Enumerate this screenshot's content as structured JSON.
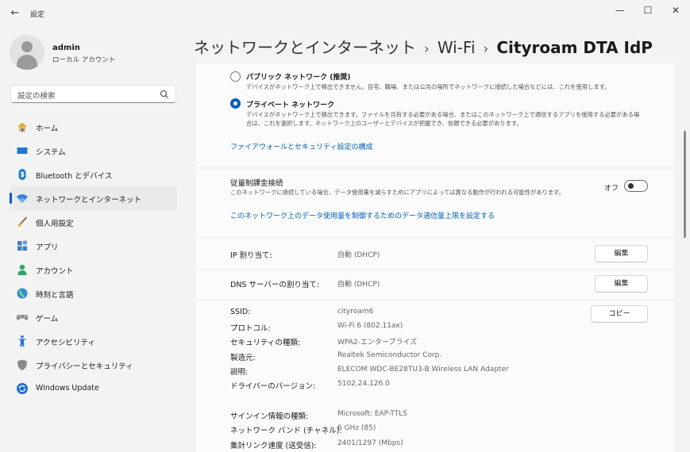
{
  "window": {
    "title": "設定",
    "back_glyph": "←",
    "min_glyph": "—",
    "max_glyph": "☐",
    "close_glyph": "✕"
  },
  "profile": {
    "name": "admin",
    "type": "ローカル アカウント"
  },
  "search": {
    "placeholder": "設定の検索"
  },
  "sidebar": {
    "items": [
      {
        "label": "ホーム",
        "icon": "home-icon"
      },
      {
        "label": "システム",
        "icon": "system-icon"
      },
      {
        "label": "Bluetooth とデバイス",
        "icon": "bluetooth-icon"
      },
      {
        "label": "ネットワークとインターネット",
        "icon": "wifi-icon",
        "active": true
      },
      {
        "label": "個人用設定",
        "icon": "brush-icon"
      },
      {
        "label": "アプリ",
        "icon": "apps-icon"
      },
      {
        "label": "アカウント",
        "icon": "account-icon"
      },
      {
        "label": "時刻と言語",
        "icon": "globe-icon"
      },
      {
        "label": "ゲーム",
        "icon": "gamepad-icon"
      },
      {
        "label": "アクセシビリティ",
        "icon": "accessibility-icon"
      },
      {
        "label": "プライバシーとセキュリティ",
        "icon": "shield-icon"
      },
      {
        "label": "Windows Update",
        "icon": "update-icon"
      }
    ]
  },
  "breadcrumb": {
    "part1": "ネットワークとインターネット",
    "part2": "Wi-Fi",
    "current": "Cityroam DTA IdP",
    "sep": "›"
  },
  "network_profile": {
    "public": {
      "title": "パブリック ネットワーク (推奨)",
      "desc": "デバイスがネットワーク上で検出できません。自宅、職場、または公共の場所でネットワークに接続した場合などには、これを使用します。",
      "checked": false
    },
    "private": {
      "title": "プライベート ネットワーク",
      "desc1": "デバイスがネットワーク上で検出できます。ファイルを共有する必要がある場合、またはこのネットワーク上で通信するアプリを使用する必要がある場",
      "desc2": "合は、これを選択します。ネットワーク上のユーザーとデバイスが把握でき、信頼できる必要があります。",
      "checked": true
    },
    "firewall_link": "ファイアウォールとセキュリティ設定の構成"
  },
  "metered": {
    "title": "従量制課金接続",
    "desc": "このネットワークに接続している場合、データ使用量を減らすためにアプリによっては異なる動作が行われる可能性があります。",
    "toggle_label": "オフ",
    "on": false,
    "data_limit_link": "このネットワーク上のデータ使用量を制御するためのデータ通信量上限を設定する"
  },
  "ip": {
    "label": "IP 割り当て:",
    "value": "自動 (DHCP)",
    "button": "編集"
  },
  "dns": {
    "label": "DNS サーバーの割り当て:",
    "value": "自動 (DHCP)",
    "button": "編集"
  },
  "properties": {
    "copy_button": "コピー",
    "rows": [
      {
        "label": "SSID:",
        "value": "cityroam6"
      },
      {
        "label": "プロトコル:",
        "value": "Wi-Fi 6 (802.11ax)"
      },
      {
        "label": "セキュリティの種類:",
        "value": "WPA2-エンタープライズ"
      },
      {
        "label": "製造元:",
        "value": "Realtek Semiconductor Corp."
      },
      {
        "label": "説明:",
        "value": "ELECOM WDC-BE28TU3-B Wireless LAN Adapter"
      },
      {
        "label": "ドライバーのバージョン:",
        "value": "5102.24.126.0"
      }
    ],
    "rows2": [
      {
        "label": "サインイン情報の種類:",
        "value": "Microsoft: EAP-TTLS"
      },
      {
        "label": "ネットワーク バンド (チャネル):",
        "value": "6 GHz (85)"
      },
      {
        "label": "集計リンク速度 (送受信):",
        "value": "2401/1297 (Mbps)"
      }
    ]
  }
}
